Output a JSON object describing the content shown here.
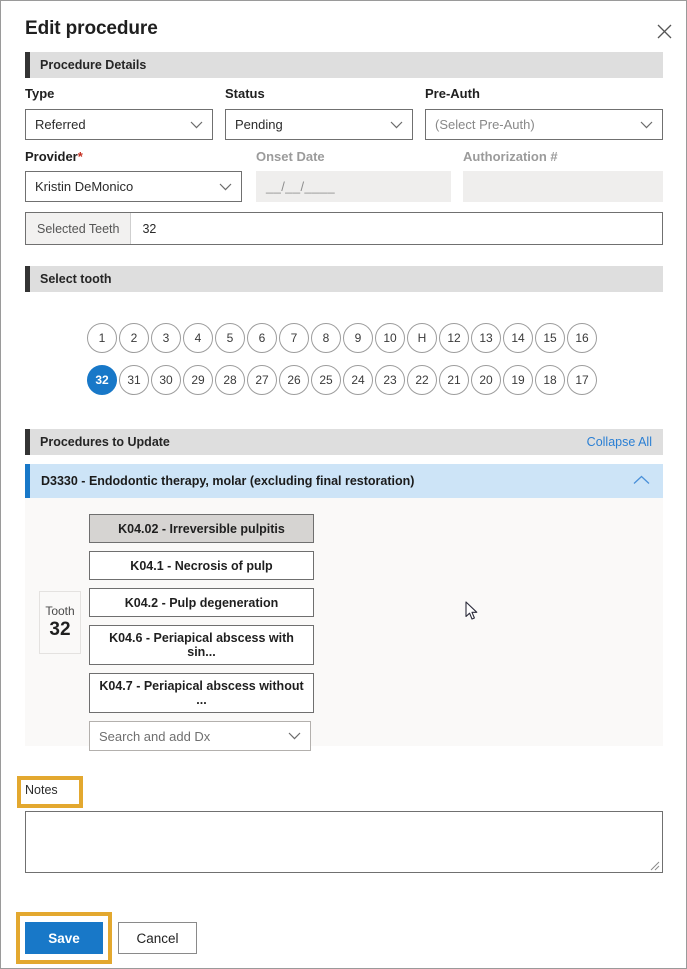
{
  "dialog": {
    "title": "Edit procedure",
    "close_icon": "close-icon"
  },
  "sections": {
    "procedure_details": {
      "title": "Procedure Details"
    },
    "select_tooth": {
      "title": "Select tooth"
    },
    "procedures_to_update": {
      "title": "Procedures to Update",
      "action": "Collapse All"
    }
  },
  "form": {
    "type": {
      "label": "Type",
      "value": "Referred"
    },
    "status": {
      "label": "Status",
      "value": "Pending"
    },
    "pre_auth": {
      "label": "Pre-Auth",
      "value": "(Select Pre-Auth)"
    },
    "provider": {
      "label": "Provider",
      "required_marker": "*",
      "value": "Kristin DeMonico"
    },
    "onset_date": {
      "label": "Onset Date",
      "placeholder": "__/__/____",
      "value": ""
    },
    "authorization": {
      "label": "Authorization #",
      "value": ""
    },
    "selected_teeth": {
      "label": "Selected Teeth",
      "value": "32"
    }
  },
  "teeth": {
    "upper": [
      "1",
      "2",
      "3",
      "4",
      "5",
      "6",
      "7",
      "8",
      "9",
      "10",
      "H",
      "12",
      "13",
      "14",
      "15",
      "16"
    ],
    "lower": [
      "32",
      "31",
      "30",
      "29",
      "28",
      "27",
      "26",
      "25",
      "24",
      "23",
      "22",
      "21",
      "20",
      "19",
      "18",
      "17"
    ],
    "selected": "32"
  },
  "procedure": {
    "code_title": "D3330 - Endodontic therapy, molar (excluding final restoration)",
    "collapse_icon": "chevron-up-icon",
    "tooth_cell": {
      "label": "Tooth",
      "number": "32"
    },
    "diagnoses": [
      {
        "label": "K04.02 - Irreversible pulpitis",
        "state": "hover"
      },
      {
        "label": "K04.1 - Necrosis of pulp",
        "state": "normal"
      },
      {
        "label": "K04.2 - Pulp degeneration",
        "state": "normal"
      },
      {
        "label": "K04.6 - Periapical abscess with sin...",
        "state": "normal"
      },
      {
        "label": "K04.7 - Periapical abscess without ...",
        "state": "normal"
      }
    ],
    "dx_search": {
      "placeholder": "Search and add Dx"
    }
  },
  "notes": {
    "label": "Notes",
    "value": ""
  },
  "footer": {
    "save_label": "Save",
    "cancel_label": "Cancel"
  },
  "colors": {
    "accent_blue": "#1878c8",
    "panel_blue": "#cde4f7",
    "section_grey": "#dedede",
    "highlight_orange": "#e3a82f"
  }
}
